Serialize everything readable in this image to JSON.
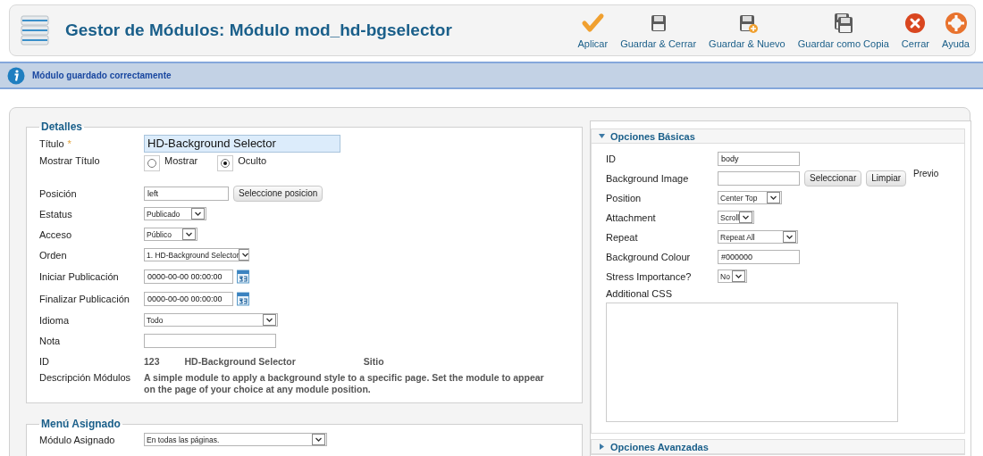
{
  "header": {
    "title": "Gestor de Módulos: Módulo mod_hd-bgselector"
  },
  "toolbar": [
    {
      "kind": "apply",
      "label": "Aplicar"
    },
    {
      "kind": "save",
      "label": "Guardar & Cerrar"
    },
    {
      "kind": "save_new",
      "label": "Guardar & Nuevo"
    },
    {
      "kind": "copy",
      "label": "Guardar como Copia"
    },
    {
      "kind": "close",
      "label": "Cerrar"
    },
    {
      "kind": "help",
      "label": "Ayuda"
    }
  ],
  "message": "Módulo guardado correctamente",
  "details": {
    "legend": "Detalles",
    "fields": [
      {
        "kind": "text",
        "label": "Título",
        "required_mark": "*",
        "value": "HD-Background Selector",
        "highlighted": true
      },
      {
        "kind": "radio",
        "label": "Mostrar Título",
        "options": [
          {
            "label": "Mostrar",
            "selected": false
          },
          {
            "label": "Oculto",
            "selected": true
          }
        ]
      },
      {
        "kind": "text",
        "label": "Posición",
        "value": "left",
        "buttons": [
          "Seleccione posicion"
        ]
      },
      {
        "kind": "select",
        "label": "Estatus",
        "value": "Publicado"
      },
      {
        "kind": "select",
        "label": "Acceso",
        "value": "Público"
      },
      {
        "kind": "select",
        "label": "Orden",
        "value": "1. HD-Background Selector"
      },
      {
        "kind": "date",
        "label": "Iniciar Publicación",
        "value": "0000-00-00 00:00:00"
      },
      {
        "kind": "date",
        "label": "Finalizar Publicación",
        "value": "0000-00-00 00:00:00"
      },
      {
        "kind": "select",
        "label": "Idioma",
        "value": "Todo"
      },
      {
        "kind": "text",
        "label": "Nota"
      },
      {
        "kind": "static",
        "label": "ID",
        "values": [
          "123",
          "HD-Background Selector",
          "Sitio"
        ]
      },
      {
        "kind": "description",
        "label": "Descripción Módulos",
        "value": "A simple module to apply a background style to a specific page. Set the module to appear on the page of your choice at any module position."
      }
    ]
  },
  "menu": {
    "legend": "Menú Asignado",
    "fields": [
      {
        "kind": "select",
        "label": "Módulo Asignado",
        "value": "En todas las páginas."
      }
    ]
  },
  "basic": {
    "title": "Opciones Básicas",
    "expanded": true,
    "fields": [
      {
        "kind": "text",
        "label": "ID",
        "value": "body"
      },
      {
        "kind": "text",
        "label": "Background Image",
        "buttons": [
          "Seleccionar",
          "Limpiar"
        ],
        "note": "Previo"
      },
      {
        "kind": "select",
        "label": "Position",
        "value": "Center Top"
      },
      {
        "kind": "select",
        "label": "Attachment",
        "value": "Scroll"
      },
      {
        "kind": "select",
        "label": "Repeat",
        "value": "Repeat All"
      },
      {
        "kind": "text",
        "label": "Background Colour",
        "value": "#000000"
      },
      {
        "kind": "select",
        "label": "Stress Importance?",
        "value": "No"
      },
      {
        "kind": "textarea",
        "label": "Additional CSS"
      }
    ]
  },
  "advanced": {
    "title": "Opciones Avanzadas",
    "expanded": false
  }
}
